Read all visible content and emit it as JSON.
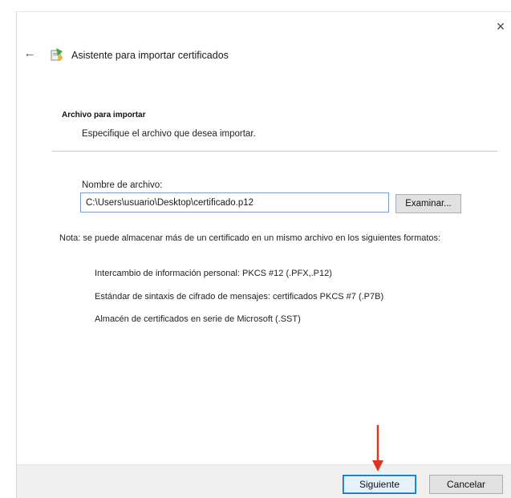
{
  "window": {
    "title": "Asistente para importar certificados",
    "close_glyph": "×",
    "back_glyph": "←",
    "icons": {
      "back": "back-arrow-icon",
      "wizard": "certificate-wizard-icon",
      "close": "close-icon",
      "annotation": "red-arrow-annotation"
    }
  },
  "section": {
    "heading": "Archivo para importar",
    "subtitle": "Especifique el archivo que desea importar."
  },
  "file": {
    "label": "Nombre de archivo:",
    "value": "C:\\Users\\usuario\\Desktop\\certificado.p12",
    "browse_label": "Examinar..."
  },
  "note": {
    "text": "Nota: se puede almacenar más de un certificado en un mismo archivo en los siguientes formatos:",
    "formats": [
      "Intercambio de información personal: PKCS #12 (.PFX,.P12)",
      "Estándar de sintaxis de cifrado de mensajes: certificados PKCS #7 (.P7B)",
      "Almacén de certificados en serie de Microsoft (.SST)"
    ]
  },
  "footer": {
    "next_label": "Siguiente",
    "cancel_label": "Cancelar"
  },
  "colors": {
    "annotation_arrow": "#e0321f",
    "focus_border": "#0078d7"
  }
}
